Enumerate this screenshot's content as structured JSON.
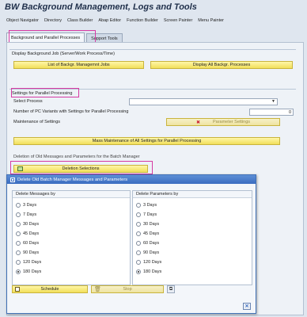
{
  "title": "BW Background Management, Logs and Tools",
  "menu": [
    "Object Navigator",
    "Directory",
    "Class Builder",
    "Abap Editor",
    "Function Builder",
    "Screen Painter",
    "Menu Painter"
  ],
  "tabs": [
    {
      "label": "Background and Parallel Processes"
    },
    {
      "label": "Support Tools"
    }
  ],
  "section_display": {
    "title": "Display Background Job (Server/Work Process/Time)",
    "btn_list": "List of Backgr. Managemnt Jobs",
    "btn_all": "Display All Backgr. Processes"
  },
  "section_settings": {
    "title": "Settings for Parallel Processing",
    "select_label": "Select Process",
    "variants_label": "Number of PC Variants with Settings for Parallel Processing",
    "variants_value": "0",
    "maintenance_label": "Maintenance of Settings",
    "param_btn": "Parameter Settings",
    "mass_btn": "Mass Maintenance of All Settings for Parallel Processing"
  },
  "section_deletion": {
    "title": "Deletion of Old Messages and Parameters for the Batch Manager",
    "btn": "Deletion Selections"
  },
  "dialog": {
    "title": "Delete Old Batch Manager Messages and Parameters",
    "messages_header": "Delete Messages by",
    "parameters_header": "Delete Parameters by",
    "messages_options": [
      "3 Days",
      "7 Days",
      "30 Days",
      "45 Days",
      "60 Days",
      "90 Days",
      "120 Days",
      "180 Days"
    ],
    "parameters_options": [
      "3 Days",
      "7 Days",
      "30 Days",
      "45 Days",
      "60 Days",
      "90 Days",
      "120 Days",
      "180 Days"
    ],
    "messages_selected": "180 Days",
    "parameters_selected": "180 Days",
    "schedule_btn": "Schedule",
    "stop_btn": "Stop"
  },
  "colors": {
    "highlight": "#d63aa3",
    "button": "#f1df59",
    "dialog_head": "#3a6cc0"
  }
}
